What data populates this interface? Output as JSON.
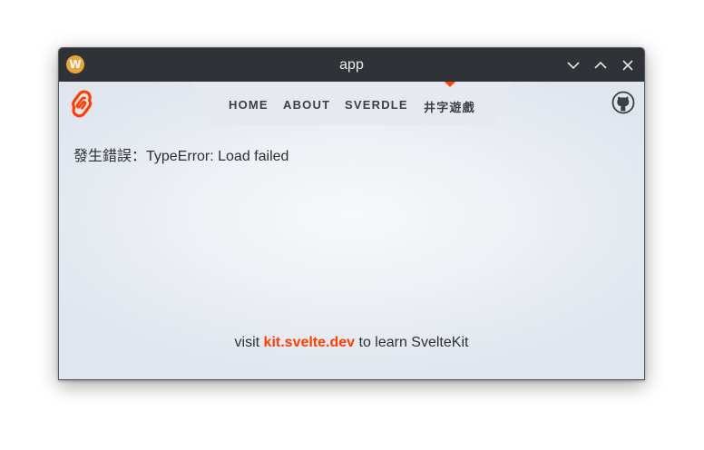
{
  "window": {
    "title": "app",
    "app_icon": "w-app-icon",
    "app_icon_letter": "W",
    "controls": [
      "minimize-icon",
      "maximize-icon",
      "close-icon"
    ]
  },
  "header": {
    "logo_icon": "svelte-logo-icon",
    "github_icon": "github-icon",
    "nav": [
      {
        "label": "HOME"
      },
      {
        "label": "ABOUT"
      },
      {
        "label": "SVERDLE"
      },
      {
        "label": "井字遊戲",
        "active": true
      }
    ]
  },
  "main": {
    "error_message": "發生錯誤：TypeError: Load failed"
  },
  "footer": {
    "prefix": "visit ",
    "link_text": "kit.svelte.dev",
    "suffix": " to learn SvelteKit"
  },
  "colors": {
    "accent": "#ff3e00",
    "titlebar": "#2f3338",
    "text": "#2d2f33"
  }
}
